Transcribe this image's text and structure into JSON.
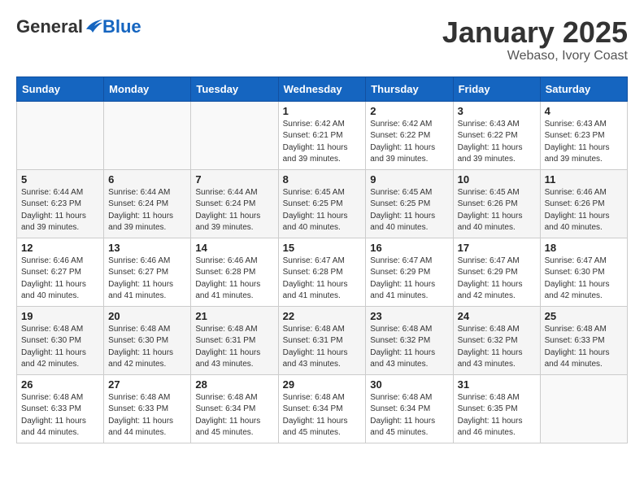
{
  "header": {
    "logo_general": "General",
    "logo_blue": "Blue",
    "month_title": "January 2025",
    "location": "Webaso, Ivory Coast"
  },
  "weekdays": [
    "Sunday",
    "Monday",
    "Tuesday",
    "Wednesday",
    "Thursday",
    "Friday",
    "Saturday"
  ],
  "weeks": [
    {
      "days": [
        {
          "num": "",
          "info": "",
          "empty": true
        },
        {
          "num": "",
          "info": "",
          "empty": true
        },
        {
          "num": "",
          "info": "",
          "empty": true
        },
        {
          "num": "1",
          "info": "Sunrise: 6:42 AM\nSunset: 6:21 PM\nDaylight: 11 hours\nand 39 minutes.",
          "empty": false
        },
        {
          "num": "2",
          "info": "Sunrise: 6:42 AM\nSunset: 6:22 PM\nDaylight: 11 hours\nand 39 minutes.",
          "empty": false
        },
        {
          "num": "3",
          "info": "Sunrise: 6:43 AM\nSunset: 6:22 PM\nDaylight: 11 hours\nand 39 minutes.",
          "empty": false
        },
        {
          "num": "4",
          "info": "Sunrise: 6:43 AM\nSunset: 6:23 PM\nDaylight: 11 hours\nand 39 minutes.",
          "empty": false
        }
      ]
    },
    {
      "days": [
        {
          "num": "5",
          "info": "Sunrise: 6:44 AM\nSunset: 6:23 PM\nDaylight: 11 hours\nand 39 minutes.",
          "empty": false
        },
        {
          "num": "6",
          "info": "Sunrise: 6:44 AM\nSunset: 6:24 PM\nDaylight: 11 hours\nand 39 minutes.",
          "empty": false
        },
        {
          "num": "7",
          "info": "Sunrise: 6:44 AM\nSunset: 6:24 PM\nDaylight: 11 hours\nand 39 minutes.",
          "empty": false
        },
        {
          "num": "8",
          "info": "Sunrise: 6:45 AM\nSunset: 6:25 PM\nDaylight: 11 hours\nand 40 minutes.",
          "empty": false
        },
        {
          "num": "9",
          "info": "Sunrise: 6:45 AM\nSunset: 6:25 PM\nDaylight: 11 hours\nand 40 minutes.",
          "empty": false
        },
        {
          "num": "10",
          "info": "Sunrise: 6:45 AM\nSunset: 6:26 PM\nDaylight: 11 hours\nand 40 minutes.",
          "empty": false
        },
        {
          "num": "11",
          "info": "Sunrise: 6:46 AM\nSunset: 6:26 PM\nDaylight: 11 hours\nand 40 minutes.",
          "empty": false
        }
      ]
    },
    {
      "days": [
        {
          "num": "12",
          "info": "Sunrise: 6:46 AM\nSunset: 6:27 PM\nDaylight: 11 hours\nand 40 minutes.",
          "empty": false
        },
        {
          "num": "13",
          "info": "Sunrise: 6:46 AM\nSunset: 6:27 PM\nDaylight: 11 hours\nand 41 minutes.",
          "empty": false
        },
        {
          "num": "14",
          "info": "Sunrise: 6:46 AM\nSunset: 6:28 PM\nDaylight: 11 hours\nand 41 minutes.",
          "empty": false
        },
        {
          "num": "15",
          "info": "Sunrise: 6:47 AM\nSunset: 6:28 PM\nDaylight: 11 hours\nand 41 minutes.",
          "empty": false
        },
        {
          "num": "16",
          "info": "Sunrise: 6:47 AM\nSunset: 6:29 PM\nDaylight: 11 hours\nand 41 minutes.",
          "empty": false
        },
        {
          "num": "17",
          "info": "Sunrise: 6:47 AM\nSunset: 6:29 PM\nDaylight: 11 hours\nand 42 minutes.",
          "empty": false
        },
        {
          "num": "18",
          "info": "Sunrise: 6:47 AM\nSunset: 6:30 PM\nDaylight: 11 hours\nand 42 minutes.",
          "empty": false
        }
      ]
    },
    {
      "days": [
        {
          "num": "19",
          "info": "Sunrise: 6:48 AM\nSunset: 6:30 PM\nDaylight: 11 hours\nand 42 minutes.",
          "empty": false
        },
        {
          "num": "20",
          "info": "Sunrise: 6:48 AM\nSunset: 6:30 PM\nDaylight: 11 hours\nand 42 minutes.",
          "empty": false
        },
        {
          "num": "21",
          "info": "Sunrise: 6:48 AM\nSunset: 6:31 PM\nDaylight: 11 hours\nand 43 minutes.",
          "empty": false
        },
        {
          "num": "22",
          "info": "Sunrise: 6:48 AM\nSunset: 6:31 PM\nDaylight: 11 hours\nand 43 minutes.",
          "empty": false
        },
        {
          "num": "23",
          "info": "Sunrise: 6:48 AM\nSunset: 6:32 PM\nDaylight: 11 hours\nand 43 minutes.",
          "empty": false
        },
        {
          "num": "24",
          "info": "Sunrise: 6:48 AM\nSunset: 6:32 PM\nDaylight: 11 hours\nand 43 minutes.",
          "empty": false
        },
        {
          "num": "25",
          "info": "Sunrise: 6:48 AM\nSunset: 6:33 PM\nDaylight: 11 hours\nand 44 minutes.",
          "empty": false
        }
      ]
    },
    {
      "days": [
        {
          "num": "26",
          "info": "Sunrise: 6:48 AM\nSunset: 6:33 PM\nDaylight: 11 hours\nand 44 minutes.",
          "empty": false
        },
        {
          "num": "27",
          "info": "Sunrise: 6:48 AM\nSunset: 6:33 PM\nDaylight: 11 hours\nand 44 minutes.",
          "empty": false
        },
        {
          "num": "28",
          "info": "Sunrise: 6:48 AM\nSunset: 6:34 PM\nDaylight: 11 hours\nand 45 minutes.",
          "empty": false
        },
        {
          "num": "29",
          "info": "Sunrise: 6:48 AM\nSunset: 6:34 PM\nDaylight: 11 hours\nand 45 minutes.",
          "empty": false
        },
        {
          "num": "30",
          "info": "Sunrise: 6:48 AM\nSunset: 6:34 PM\nDaylight: 11 hours\nand 45 minutes.",
          "empty": false
        },
        {
          "num": "31",
          "info": "Sunrise: 6:48 AM\nSunset: 6:35 PM\nDaylight: 11 hours\nand 46 minutes.",
          "empty": false
        },
        {
          "num": "",
          "info": "",
          "empty": true
        }
      ]
    }
  ]
}
